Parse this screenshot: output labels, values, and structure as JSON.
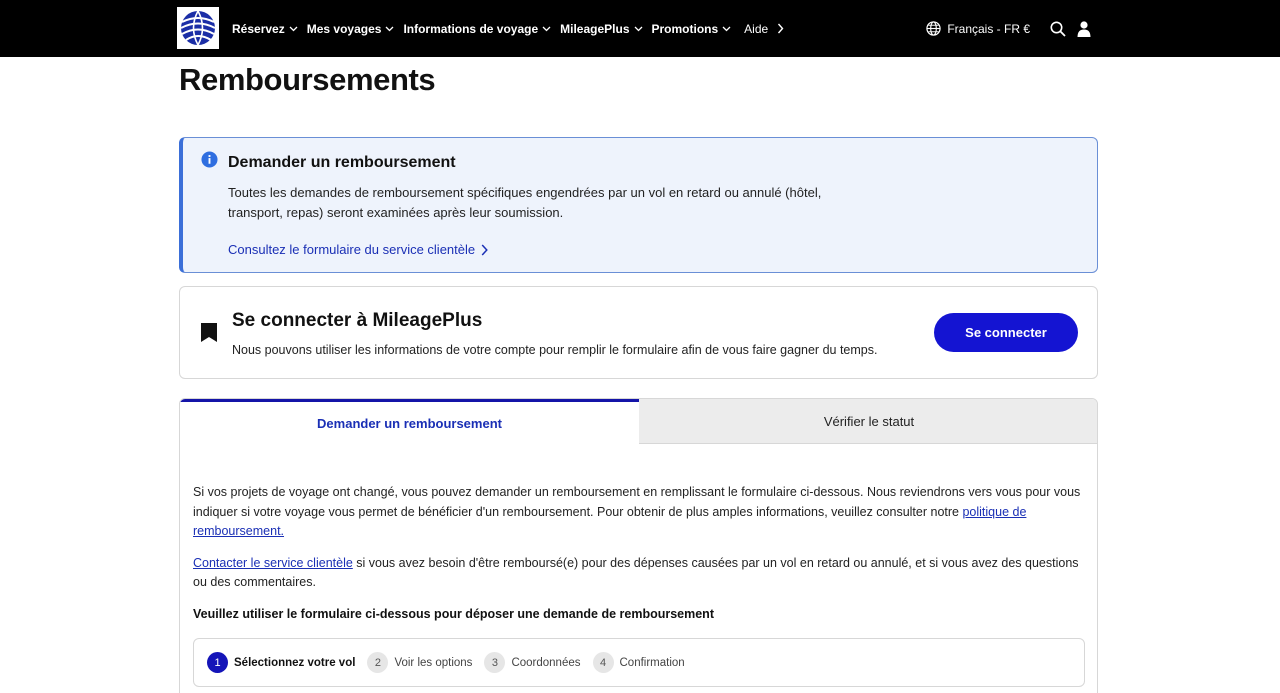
{
  "nav": {
    "items": [
      {
        "label": "Réservez"
      },
      {
        "label": "Mes voyages"
      },
      {
        "label": "Informations de voyage"
      },
      {
        "label": "MileagePlus"
      },
      {
        "label": "Promotions"
      }
    ],
    "aide": "Aide",
    "language": "Français - FR €"
  },
  "page": {
    "title": "Remboursements"
  },
  "info": {
    "title": "Demander un remboursement",
    "text": "Toutes les demandes de remboursement spécifiques engendrées par un vol en retard ou annulé (hôtel, transport, repas) seront examinées après leur soumission.",
    "link": "Consultez le formulaire du service clientèle"
  },
  "login": {
    "title": "Se connecter à MileagePlus",
    "description": "Nous pouvons utiliser les informations de votre compte pour remplir le formulaire afin de vous faire gagner du temps.",
    "button": "Se connecter"
  },
  "tabs": {
    "request": "Demander un remboursement",
    "status": "Vérifier le statut"
  },
  "body": {
    "p1_text": "Si vos projets de voyage ont changé, vous pouvez demander un remboursement en remplissant le formulaire ci-dessous. Nous reviendrons vers vous pour vous indiquer si votre voyage vous permet de bénéficier d'un remboursement. Pour obtenir de plus amples informations, veuillez consulter notre ",
    "p1_link": "politique de remboursement.",
    "p2_link": "Contacter le service clientèle",
    "p2_text": " si vous avez besoin d'être remboursé(e) pour des dépenses causées par un vol en retard ou annulé, et si vous avez des questions ou des commentaires.",
    "form_heading": "Veuillez utiliser le formulaire ci-dessous pour déposer une demande de remboursement"
  },
  "stepper": {
    "steps": [
      {
        "num": "1",
        "label": "Sélectionnez votre vol"
      },
      {
        "num": "2",
        "label": "Voir les options"
      },
      {
        "num": "3",
        "label": "Coordonnées"
      },
      {
        "num": "4",
        "label": "Confirmation"
      }
    ]
  },
  "colors": {
    "accent": "#1414d2",
    "link": "#1a2fb5",
    "info_bg": "#eef3fc",
    "info_border": "#3b6fd8"
  }
}
